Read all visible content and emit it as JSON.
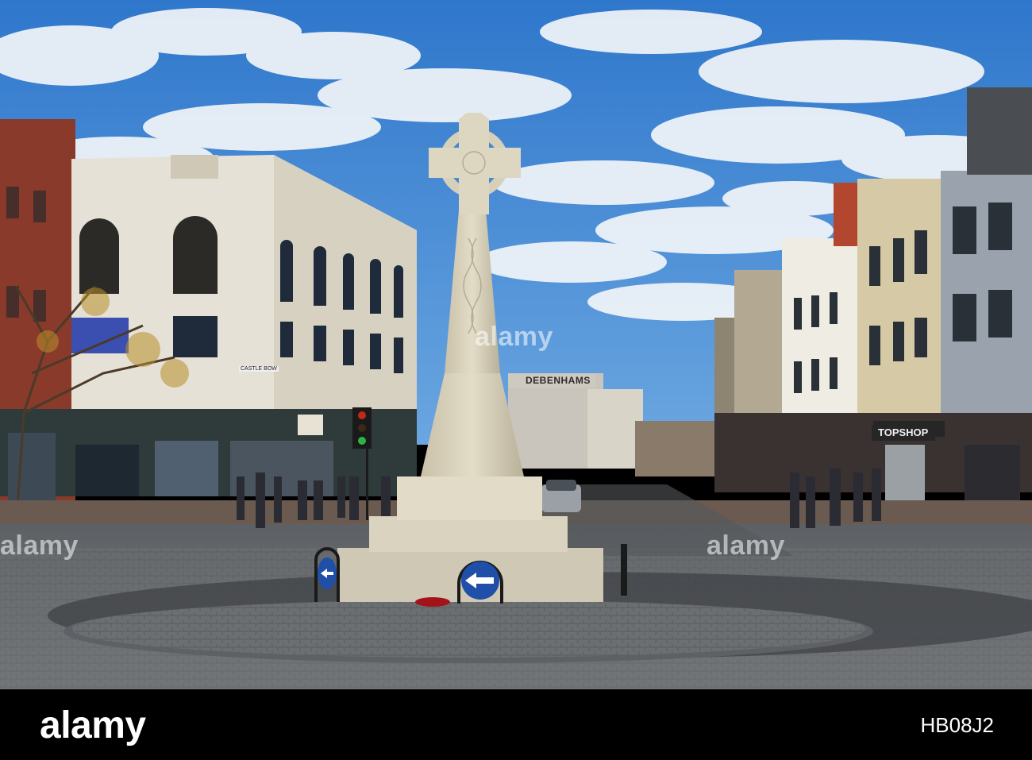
{
  "scene": {
    "signs": {
      "department_store": "DEBENHAMS",
      "fashion_store": "TOPSHOP",
      "street_sign": "CASTLE BOW"
    }
  },
  "watermark": {
    "text": "alamy"
  },
  "footer": {
    "brand": "alamy",
    "image_id": "HB08J2"
  },
  "colors": {
    "sky": "#3f86d4",
    "stone": "#d9d2bd",
    "cobbles": "#6f7174",
    "sign_blue": "#1f4fa8",
    "footer_bg": "#000000"
  }
}
